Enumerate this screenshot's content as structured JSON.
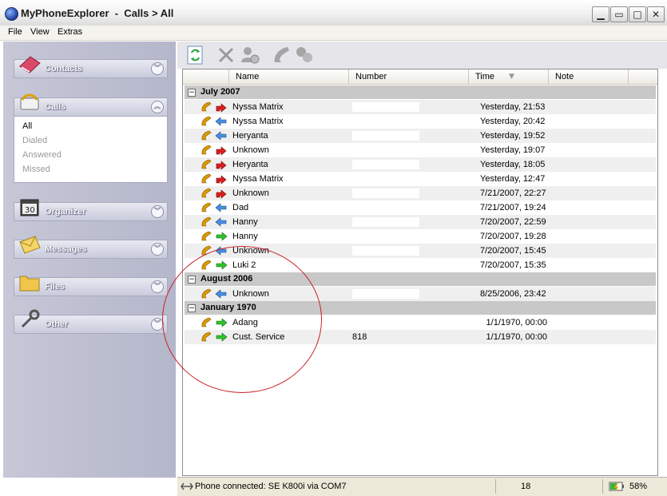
{
  "window": {
    "title": "MyPhoneExplorer  -  Calls > All",
    "minimize_glyph": "▁",
    "restore_glyph": "▭",
    "maximize_glyph": "□",
    "close_glyph": "✕"
  },
  "menu": {
    "items": [
      "File",
      "View",
      "Extras"
    ]
  },
  "sidebar": {
    "sections": [
      {
        "label": "Contacts",
        "expanded": false,
        "chevron": "︾"
      },
      {
        "label": "Calls",
        "expanded": true,
        "chevron": "︽"
      },
      {
        "label": "Organizer",
        "expanded": false,
        "chevron": "︾"
      },
      {
        "label": "Messages",
        "expanded": false,
        "chevron": "︾"
      },
      {
        "label": "Files",
        "expanded": false,
        "chevron": "︾"
      },
      {
        "label": "Other",
        "expanded": false,
        "chevron": "︾"
      }
    ],
    "calls_items": [
      "All",
      "Dialed",
      "Answered",
      "Missed"
    ],
    "calls_active": "All"
  },
  "toolbar": {
    "icons": [
      "refresh-icon",
      "delete-icon",
      "add-contact-icon",
      "call-icon",
      "chat-icon"
    ]
  },
  "table": {
    "headers": [
      "Name",
      "Number",
      "Time",
      "Note"
    ],
    "sort_glyph": "▼",
    "groups": [
      {
        "label": "July 2007",
        "rows": [
          {
            "name": "Nyssa Matrix",
            "number": "",
            "time": "Yesterday, 21:53",
            "type": "missed"
          },
          {
            "name": "Nyssa Matrix",
            "number": "",
            "time": "Yesterday, 20:42",
            "type": "received"
          },
          {
            "name": "Heryanta",
            "number": "",
            "time": "Yesterday, 19:52",
            "type": "received"
          },
          {
            "name": "Unknown",
            "number": "",
            "time": "Yesterday, 19:07",
            "type": "missed"
          },
          {
            "name": "Heryanta",
            "number": "",
            "time": "Yesterday, 18:05",
            "type": "missed"
          },
          {
            "name": "Nyssa Matrix",
            "number": "",
            "time": "Yesterday, 12:47",
            "type": "missed"
          },
          {
            "name": "Unknown",
            "number": "",
            "time": "7/21/2007, 22:27",
            "type": "missed"
          },
          {
            "name": "Dad",
            "number": "",
            "time": "7/21/2007, 19:24",
            "type": "received"
          },
          {
            "name": "Hanny",
            "number": "",
            "time": "7/20/2007, 22:59",
            "type": "received"
          },
          {
            "name": "Hanny",
            "number": "",
            "time": "7/20/2007, 19:28",
            "type": "dialed"
          },
          {
            "name": "Unknown",
            "number": "",
            "time": "7/20/2007, 15:45",
            "type": "received"
          },
          {
            "name": "Luki 2",
            "number": "",
            "time": "7/20/2007, 15:35",
            "type": "dialed"
          }
        ]
      },
      {
        "label": "August 2006",
        "rows": [
          {
            "name": "Unknown",
            "number": "",
            "time": "8/25/2006, 23:42",
            "type": "received"
          }
        ]
      },
      {
        "label": "January 1970",
        "rows": [
          {
            "name": "Adang",
            "number": "",
            "time": "1/1/1970, 00:00",
            "type": "dialed"
          },
          {
            "name": "Cust. Service",
            "number": "818",
            "time": "1/1/1970, 00:00",
            "type": "dialed"
          }
        ]
      }
    ]
  },
  "status": {
    "connection": "Phone connected: SE K800i via COM7",
    "count": "18",
    "battery": "58%"
  },
  "colors": {
    "annotation": "#c8232a",
    "group_bg": "#c8c8c8"
  }
}
